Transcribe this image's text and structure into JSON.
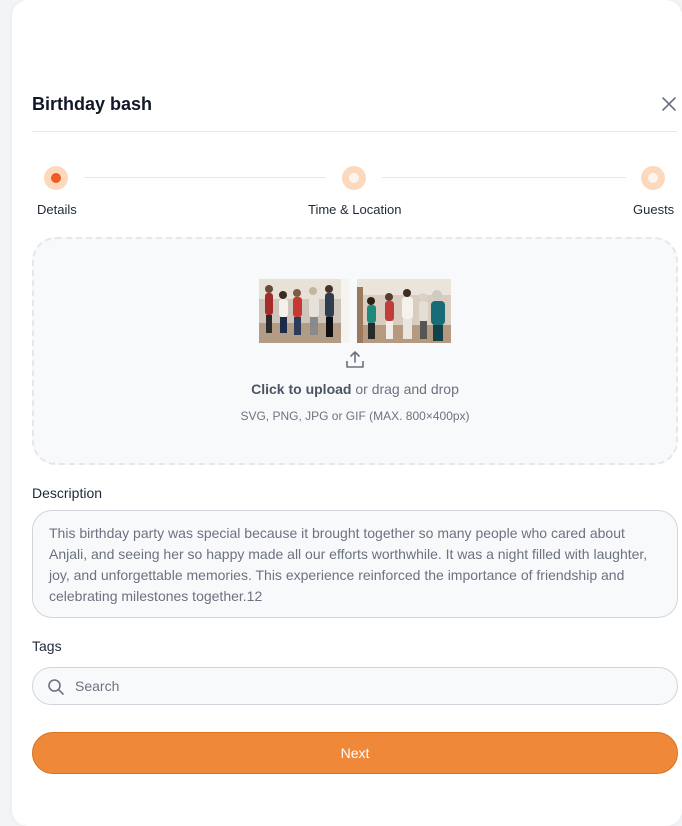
{
  "dialog": {
    "title": "Birthday bash"
  },
  "stepper": {
    "steps": [
      {
        "label": "Details",
        "state": "active"
      },
      {
        "label": "Time & Location",
        "state": "pending"
      },
      {
        "label": "Guests",
        "state": "pending"
      }
    ],
    "active_color": "#f15a22",
    "ring_color": "#fcd9bd",
    "pending_inner_color": "#fff4ec"
  },
  "upload": {
    "cta": "Click to upload",
    "rest": " or drag and drop",
    "hint": "SVG, PNG, JPG or GIF (MAX. 800×400px)",
    "icon": "upload-icon"
  },
  "description": {
    "label": "Description",
    "value": "This birthday party was special because it brought together so many people who cared about Anjali, and seeing her so happy made all our efforts worthwhile. It was a night filled with laughter, joy, and unforgettable memories. This experience reinforced the importance of friendship and celebrating milestones together.12"
  },
  "tags": {
    "label": "Tags",
    "placeholder": "Search"
  },
  "actions": {
    "next_label": "Next",
    "accent": "#f0883a"
  }
}
